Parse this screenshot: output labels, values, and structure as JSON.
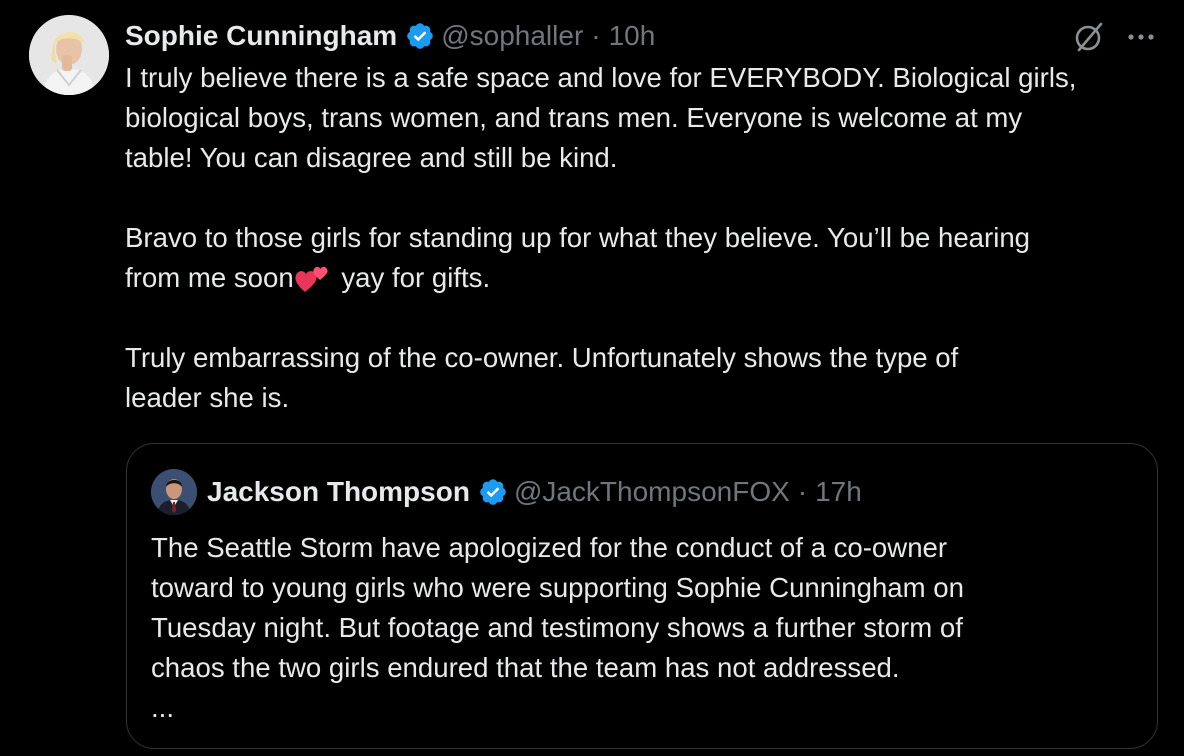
{
  "tweet": {
    "author": {
      "display_name": "Sophie Cunningham",
      "handle": "@sophaller",
      "verified": true
    },
    "separator": "·",
    "time": "10h",
    "icons": [
      "grok-icon",
      "more-icon"
    ],
    "text_lines": {
      "p1": [
        "I truly believe there is a safe space and love for EVERYBODY. Biological girls,",
        "biological boys, trans women, and trans men. Everyone is welcome at my",
        "table! You can disagree and still be kind."
      ],
      "p2_line1": "Bravo to those girls for standing up for what they believe. You’ll be hearing",
      "p2_line2_before": "from me soon",
      "p2_line2_after": " yay for gifts.",
      "p2_emoji": "two-hearts-emoji",
      "p3": [
        "Truly embarrassing of the co-owner. Unfortunately shows the type of",
        "leader she is."
      ]
    }
  },
  "quote": {
    "author": {
      "display_name": "Jackson Thompson",
      "handle": "@JackThompsonFOX",
      "verified": true
    },
    "separator": "·",
    "time": "17h",
    "text_lines": [
      "The Seattle Storm have apologized for the conduct of a co-owner",
      "toward to young girls who were supporting Sophie Cunningham on",
      "Tuesday night. But footage and testimony shows a further storm of",
      "chaos the two girls endured that the team has not addressed.",
      "..."
    ]
  },
  "colors": {
    "background": "#000000",
    "text": "#e7e9ea",
    "secondary": "#71767b",
    "verified": "#1d9bf0",
    "border": "#2f3336",
    "heart": "#e8355a"
  }
}
